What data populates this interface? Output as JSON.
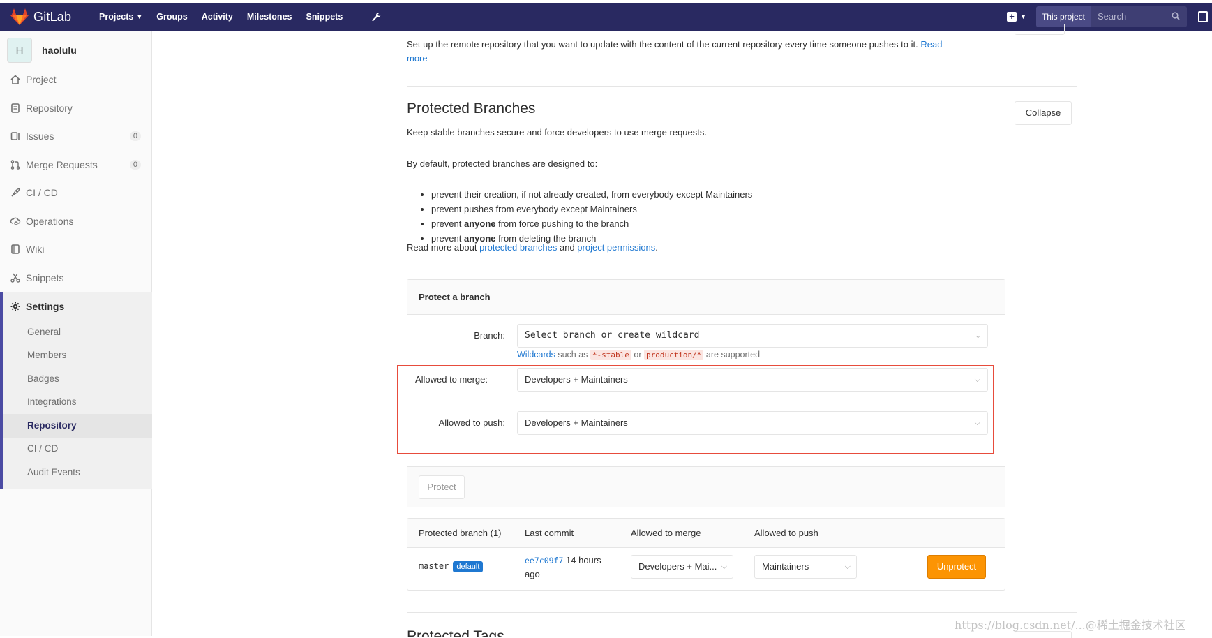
{
  "topbar": {
    "brand": "GitLab",
    "nav": [
      {
        "label": "Projects",
        "dropdown": true
      },
      {
        "label": "Groups",
        "dropdown": false
      },
      {
        "label": "Activity",
        "dropdown": false
      },
      {
        "label": "Milestones",
        "dropdown": false
      },
      {
        "label": "Snippets",
        "dropdown": false
      }
    ],
    "scope": "This project",
    "search_placeholder": "Search"
  },
  "sidebar": {
    "avatar_letter": "H",
    "project_name": "haolulu",
    "items": [
      {
        "label": "Project",
        "icon": "home-icon"
      },
      {
        "label": "Repository",
        "icon": "doc-icon"
      },
      {
        "label": "Issues",
        "icon": "issues-icon",
        "count": "0"
      },
      {
        "label": "Merge Requests",
        "icon": "merge-request-icon",
        "count": "0"
      },
      {
        "label": "CI / CD",
        "icon": "rocket-icon"
      },
      {
        "label": "Operations",
        "icon": "cloud-gear-icon"
      },
      {
        "label": "Wiki",
        "icon": "book-icon"
      },
      {
        "label": "Snippets",
        "icon": "scissors-icon"
      }
    ],
    "settings_label": "Settings",
    "settings_items": [
      "General",
      "Members",
      "Badges",
      "Integrations",
      "Repository",
      "CI / CD",
      "Audit Events"
    ],
    "active_settings_item": "Repository"
  },
  "mirror": {
    "text": "Set up the remote repository that you want to update with the content of the current repository every time someone pushes to it.",
    "read_more": "Read more"
  },
  "protected": {
    "title": "Protected Branches",
    "collapse_label": "Collapse",
    "subtitle": "Keep stable branches secure and force developers to use merge requests.",
    "by_default": "By default, protected branches are designed to:",
    "rules": [
      {
        "pre": "prevent their creation, if not already created, from everybody except Maintainers",
        "bold": "",
        "post": ""
      },
      {
        "pre": "prevent pushes from everybody except Maintainers",
        "bold": "",
        "post": ""
      },
      {
        "pre": "prevent ",
        "bold": "anyone",
        "post": " from force pushing to the branch"
      },
      {
        "pre": "prevent ",
        "bold": "anyone",
        "post": " from deleting the branch"
      }
    ],
    "read_more_pre": "Read more about ",
    "link1": "protected branches",
    "and": " and ",
    "link2": "project permissions",
    "period": "."
  },
  "protect_form": {
    "title": "Protect a branch",
    "branch_label": "Branch:",
    "branch_placeholder": "Select branch or create wildcard",
    "hint_link": "Wildcards",
    "hint_such_as": " such as ",
    "hint_code1": "*-stable",
    "hint_or": " or ",
    "hint_code2": "production/*",
    "hint_end": " are supported",
    "merge_label": "Allowed to merge:",
    "merge_value": "Developers + Maintainers",
    "push_label": "Allowed to push:",
    "push_value": "Developers + Maintainers",
    "protect_button": "Protect"
  },
  "table": {
    "headers": [
      "Protected branch (1)",
      "Last commit",
      "Allowed to merge",
      "Allowed to push"
    ],
    "row": {
      "branch": "master",
      "badge": "default",
      "commit_sha": "ee7c09f7",
      "commit_time": "14 hours ago",
      "merge": "Developers + Mai...",
      "push": "Maintainers",
      "unprotect": "Unprotect"
    }
  },
  "next_section_title": "Protected Tags",
  "watermark": "https://blog.csdn.net/...@稀土掘金技术社区",
  "colors": {
    "topbar": "#292961",
    "accent": "#1f78d1",
    "warning": "#fc9403",
    "highlight_box": "#e74c3c"
  }
}
